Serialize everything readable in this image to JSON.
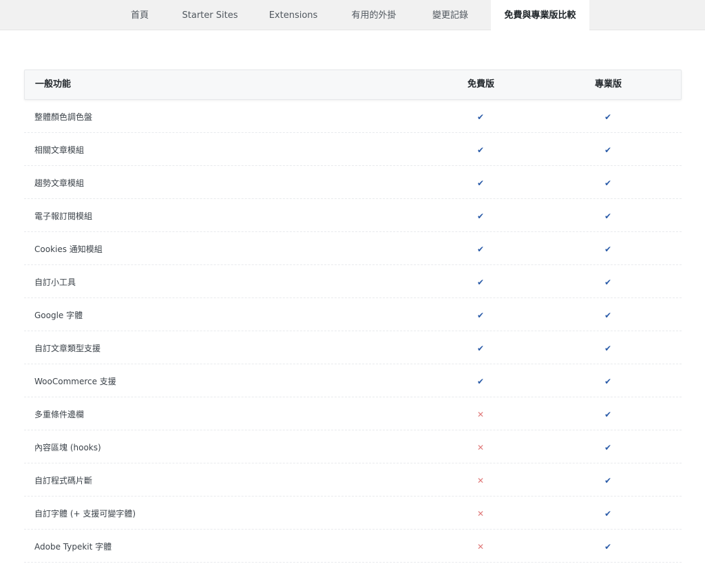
{
  "tabs": [
    {
      "label": "首頁",
      "active": false
    },
    {
      "label": "Starter Sites",
      "active": false
    },
    {
      "label": "Extensions",
      "active": false
    },
    {
      "label": "有用的外掛",
      "active": false
    },
    {
      "label": "變更記錄",
      "active": false
    },
    {
      "label": "免費與專業版比較",
      "active": true
    }
  ],
  "table": {
    "headers": {
      "feature": "一般功能",
      "free": "免費版",
      "pro": "專業版"
    },
    "rows": [
      {
        "feature": "整體顏色調色盤",
        "free": true,
        "pro": true
      },
      {
        "feature": "相關文章模組",
        "free": true,
        "pro": true
      },
      {
        "feature": "趨勢文章模組",
        "free": true,
        "pro": true
      },
      {
        "feature": "電子報訂閱模組",
        "free": true,
        "pro": true
      },
      {
        "feature": "Cookies 通知模組",
        "free": true,
        "pro": true
      },
      {
        "feature": "自訂小工具",
        "free": true,
        "pro": true
      },
      {
        "feature": "Google 字體",
        "free": true,
        "pro": true
      },
      {
        "feature": "自訂文章類型支援",
        "free": true,
        "pro": true
      },
      {
        "feature": "WooCommerce 支援",
        "free": true,
        "pro": true
      },
      {
        "feature": "多重條件邊欄",
        "free": false,
        "pro": true
      },
      {
        "feature": "內容區塊 (hooks)",
        "free": false,
        "pro": true
      },
      {
        "feature": "自訂程式碼片斷",
        "free": false,
        "pro": true
      },
      {
        "feature": "自訂字體 (+ 支援可變字體)",
        "free": false,
        "pro": true
      },
      {
        "feature": "Adobe Typekit 字體",
        "free": false,
        "pro": true
      }
    ]
  },
  "icons": {
    "yes": "check-icon",
    "no": "cross-icon"
  },
  "colors": {
    "check": "#2a5ba8",
    "cross": "#e07a7a",
    "tabbar_bg": "#f1f1f1",
    "header_bg": "#f7f8f9"
  }
}
